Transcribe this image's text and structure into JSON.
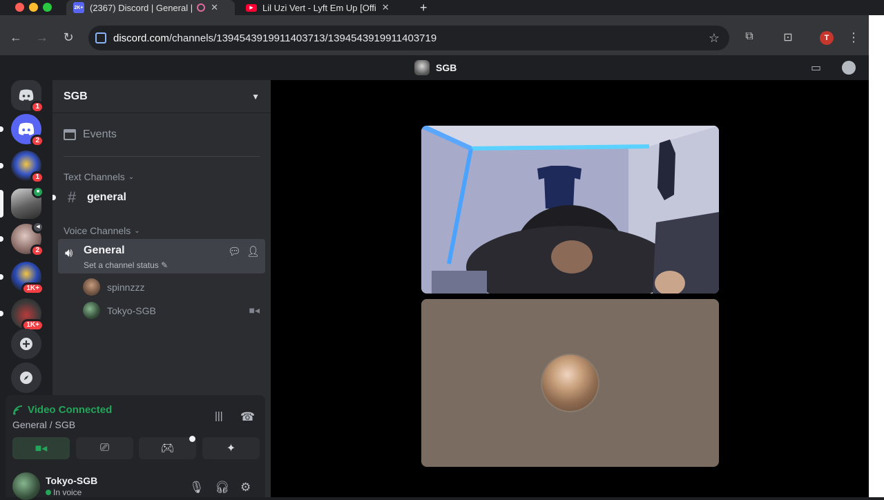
{
  "browser": {
    "tabs": [
      {
        "title": "(2367) Discord | General |",
        "badge": "2K+",
        "active": true
      },
      {
        "title": "Lil Uzi Vert - Lyft Em Up [Offi",
        "active": false
      }
    ],
    "url_host": "discord.com",
    "url_path": "/channels/1394543919911403713/1394543919911403719",
    "profile_initial": "T"
  },
  "title_bar": {
    "server_name": "SGB"
  },
  "rail": {
    "servers": [
      {
        "name": "dm-home",
        "badge": "1"
      },
      {
        "name": "discord",
        "badge": "2"
      },
      {
        "name": "elevate",
        "badge": "1"
      },
      {
        "name": "sgb",
        "badge": ""
      },
      {
        "name": "voice-server",
        "badge": "2"
      },
      {
        "name": "elevate-2",
        "badge": "1K+"
      },
      {
        "name": "mysportpick",
        "badge": "1K+"
      }
    ]
  },
  "sidebar": {
    "server_name": "SGB",
    "events_label": "Events",
    "text_category": "Text Channels",
    "text_channel": "general",
    "voice_category": "Voice Channels",
    "voice_channel": {
      "name": "General",
      "status": "Set a channel status",
      "members": [
        {
          "name": "spinnzzz",
          "camera": false
        },
        {
          "name": "Tokyo-SGB",
          "camera": true
        }
      ]
    }
  },
  "voice_panel": {
    "title": "Video Connected",
    "subtitle": "General / SGB",
    "user": {
      "name": "Tokyo-SGB",
      "status": "In voice"
    }
  },
  "colors": {
    "connected_green": "#23a55a",
    "badge_red": "#f23f43",
    "blurple": "#5865f2"
  }
}
